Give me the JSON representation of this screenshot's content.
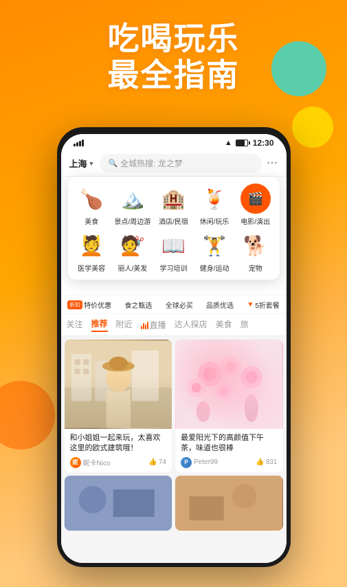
{
  "hero": {
    "line1": "吃喝玩乐",
    "line2": "最全指南"
  },
  "status_bar": {
    "city": "上海",
    "time": "12:30",
    "search_placeholder": "全城热搜: 龙之梦"
  },
  "categories": {
    "row1": [
      {
        "id": "food",
        "icon": "🍗",
        "label": "美食"
      },
      {
        "id": "scenic",
        "icon": "🏔️",
        "label": "景点/周边游"
      },
      {
        "id": "hotel",
        "icon": "🏨",
        "label": "酒店/民宿"
      },
      {
        "id": "leisure",
        "icon": "🍹",
        "label": "休闲/玩乐"
      },
      {
        "id": "movie",
        "icon": "🎬",
        "label": "电影/演出"
      }
    ],
    "row2": [
      {
        "id": "medical",
        "icon": "💆",
        "label": "医学美容"
      },
      {
        "id": "beauty",
        "icon": "💇",
        "label": "丽人/美发"
      },
      {
        "id": "study",
        "icon": "📖",
        "label": "学习培训"
      },
      {
        "id": "fitness",
        "icon": "🏋️",
        "label": "健身/运动"
      },
      {
        "id": "pet",
        "icon": "🐕",
        "label": "宠物"
      }
    ]
  },
  "promo_strip": [
    {
      "id": "discount",
      "badge": "折扣",
      "text": "特价优惠"
    },
    {
      "id": "food_deals",
      "text": "食之甄选"
    },
    {
      "id": "must_buy",
      "text": "全球必买"
    },
    {
      "id": "brand",
      "text": "品质优选"
    },
    {
      "id": "five_star",
      "text": "5折套餐"
    }
  ],
  "tabs": [
    {
      "id": "follow",
      "label": "关注",
      "active": false
    },
    {
      "id": "recommend",
      "label": "推荐",
      "active": true
    },
    {
      "id": "nearby",
      "label": "附近",
      "active": false
    },
    {
      "id": "live",
      "label": "直播",
      "active": false,
      "has_bars": true
    },
    {
      "id": "explore",
      "label": "达人探店",
      "active": false
    },
    {
      "id": "food_tab",
      "label": "美食",
      "active": false
    },
    {
      "id": "more_tab",
      "label": "旅",
      "active": false
    }
  ],
  "cards": {
    "left": {
      "title": "和小姐姐一起来玩，太喜欢这里的欧式建筑哦！",
      "author": "妮卡Nico",
      "likes": "74"
    },
    "right": {
      "title": "最爱阳光下的高颜值下午茶，味道也很棒",
      "author": "Peter99",
      "likes": "831"
    }
  },
  "icons": {
    "search": "🔍",
    "chevron_down": "∨",
    "more": "···",
    "thumb_up": "👍",
    "live_bars": "📊"
  }
}
